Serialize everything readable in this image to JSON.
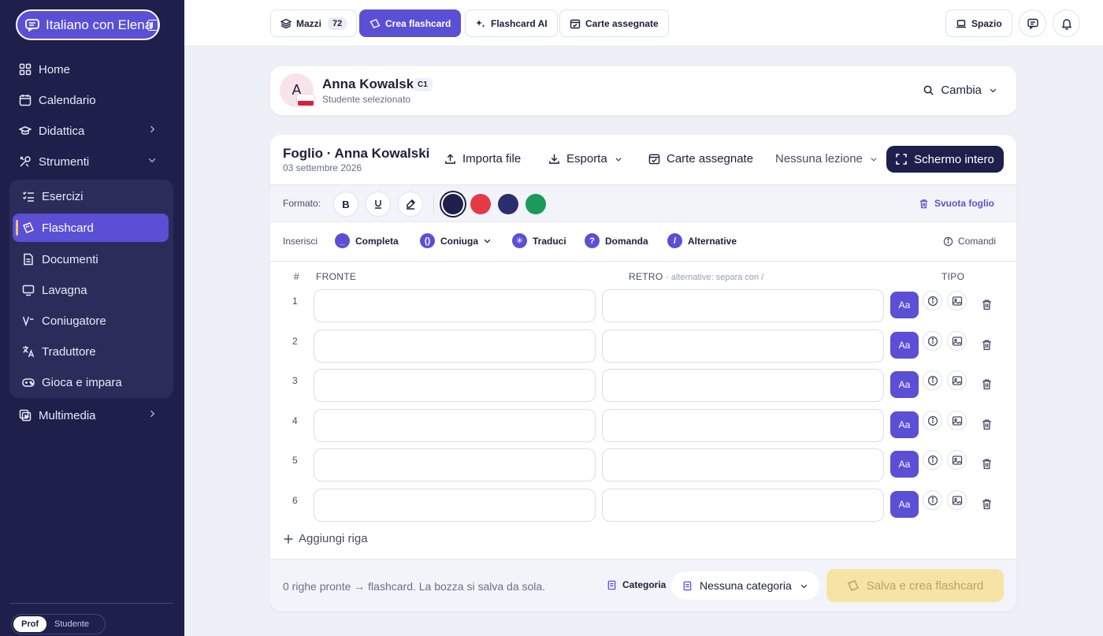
{
  "sidebar": {
    "brand": "Italiano con Elena",
    "items": [
      {
        "label": "Home"
      },
      {
        "label": "Calendario"
      },
      {
        "label": "Didattica"
      },
      {
        "label": "Strumenti"
      },
      {
        "label": "Multimedia"
      }
    ],
    "tools": [
      {
        "label": "Esercizi"
      },
      {
        "label": "Flashcard",
        "active": true
      },
      {
        "label": "Documenti"
      },
      {
        "label": "Lavagna"
      },
      {
        "label": "Coniugatore"
      },
      {
        "label": "Traduttore"
      },
      {
        "label": "Gioca e impara"
      }
    ],
    "roles": {
      "prof": "Prof",
      "student": "Studente",
      "selected": "Prof"
    }
  },
  "topbar": {
    "mazzi": "Mazzi",
    "mazzi_count": "72",
    "crea": "Crea flashcard",
    "ai": "Flashcard AI",
    "assegnate": "Carte assegnate",
    "spazio": "Spazio"
  },
  "student": {
    "initial": "A",
    "name": "Anna Kowalski",
    "level": "C1",
    "subtitle": "Studente selezionato",
    "change": "Cambia"
  },
  "sheet": {
    "title": "Foglio · Anna Kowalski",
    "date": "03 settembre 2026",
    "import": "Importa file",
    "export": "Esporta",
    "assigned": "Carte assegnate",
    "lesson": "Nessuna lezione",
    "fullscreen": "Schermo intero",
    "format_label": "Formato:",
    "format_bold": "B",
    "colors": [
      "#1e1f4b",
      "#e63946",
      "#2b2d6e",
      "#1b9a5a"
    ],
    "selected_color": "#1e1f4b",
    "clear": "Svuota foglio",
    "insert_label": "Inserisci",
    "inserts": [
      {
        "label": "Completa",
        "glyph": "_"
      },
      {
        "label": "Coniuga",
        "glyph": "()"
      },
      {
        "label": "Traduci",
        "glyph": "✳"
      },
      {
        "label": "Domanda",
        "glyph": "?"
      },
      {
        "label": "Alternative",
        "glyph": "/"
      }
    ],
    "commands": "Comandi",
    "columns": {
      "num": "#",
      "front": "FRONTE",
      "back": "RETRO",
      "back_hint": "· alternative: separa con /",
      "type": "TIPO"
    },
    "rows": [
      {
        "num": "1",
        "type": "Aa"
      },
      {
        "num": "2",
        "type": "Aa"
      },
      {
        "num": "3",
        "type": "Aa"
      },
      {
        "num": "4",
        "type": "Aa"
      },
      {
        "num": "5",
        "type": "Aa"
      },
      {
        "num": "6",
        "type": "Aa"
      }
    ],
    "add_row": "Aggiungi riga",
    "footer_text": "0 righe pronte → flashcard. La bozza si salva da sola.",
    "category_label": "Categoria",
    "category_value": "Nessuna categoria",
    "save": "Salva e crea flashcard"
  }
}
